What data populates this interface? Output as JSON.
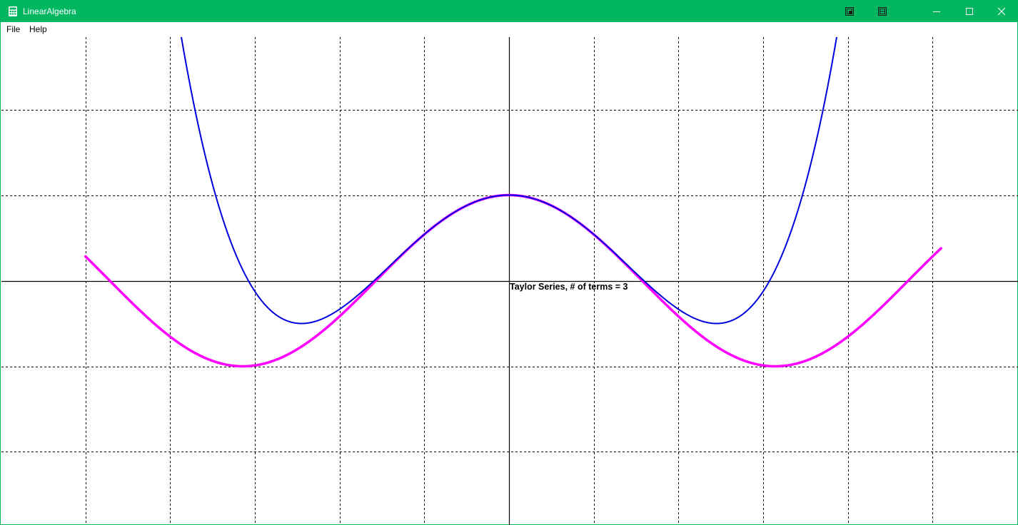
{
  "window": {
    "title": "LinearAlgebra",
    "icon": "calculator-icon",
    "colors": {
      "titlebar": "#00b760",
      "border": "#00b460"
    }
  },
  "menu": {
    "items": [
      {
        "label": "File"
      },
      {
        "label": "Help"
      }
    ]
  },
  "plot": {
    "annotation": "Taylor Series, # of terms = 3",
    "colors": {
      "exact": "#ff00ff",
      "approx": "#0000dd",
      "axis": "#000000",
      "grid": "#000000",
      "background": "#ffffff"
    },
    "terms": 3
  },
  "chart_data": {
    "type": "line",
    "grid": true,
    "xlim": [
      -6,
      6
    ],
    "ylim": [
      -2.85,
      2.85
    ],
    "x_gridlines": [
      -5,
      -4,
      -3,
      -2,
      -1,
      1,
      2,
      3,
      4,
      5
    ],
    "y_gridlines": [
      -2,
      -1,
      1,
      2
    ],
    "series": [
      {
        "function": "cos(x)",
        "domain": [
          -5,
          5.1
        ],
        "color": "#ff00ff"
      },
      {
        "function": "1 - x^2/2 + x^4/24",
        "domain": [
          -6,
          6
        ],
        "color": "#0000dd"
      }
    ]
  }
}
